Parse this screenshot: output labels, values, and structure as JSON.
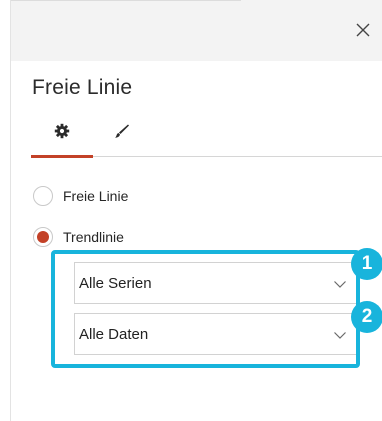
{
  "panel": {
    "title": "Freie Linie",
    "close_icon": "close-icon"
  },
  "tabs": [
    {
      "name": "settings",
      "icon": "gear-icon",
      "selected": true
    },
    {
      "name": "format",
      "icon": "brush-icon",
      "selected": false
    }
  ],
  "options": [
    {
      "label": "Freie Linie",
      "selected": false
    },
    {
      "label": "Trendlinie",
      "selected": true
    }
  ],
  "selects": [
    {
      "value": "Alle Serien",
      "icon": "chevron-down-icon"
    },
    {
      "value": "Alle Daten",
      "icon": "chevron-down-icon"
    }
  ],
  "callouts": [
    {
      "number": "1"
    },
    {
      "number": "2"
    }
  ],
  "colors": {
    "accent": "#c34127",
    "highlight": "#18b4dc",
    "header_bg": "#f3f3f3"
  }
}
